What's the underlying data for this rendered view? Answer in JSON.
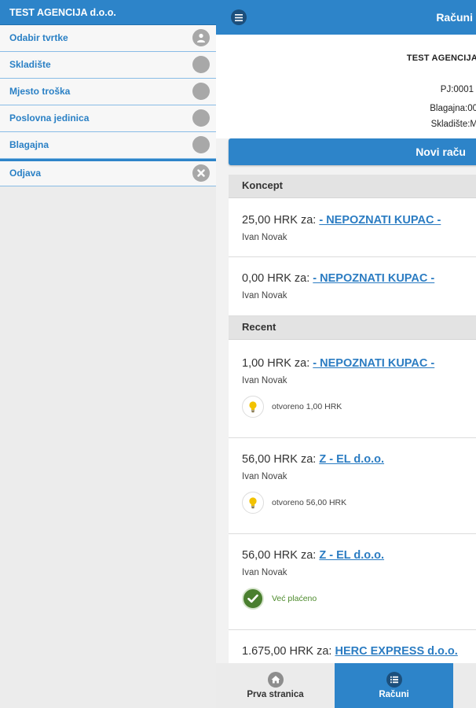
{
  "sidebar": {
    "title": "TEST AGENCIJA d.o.o.",
    "items": [
      {
        "label": "Odabir tvrtke",
        "icon": "user-icon"
      },
      {
        "label": "Skladište",
        "icon": "circle-icon"
      },
      {
        "label": "Mjesto troška",
        "icon": "circle-icon"
      },
      {
        "label": "Poslovna jedinica",
        "icon": "circle-icon"
      },
      {
        "label": "Blagajna",
        "icon": "circle-icon"
      },
      {
        "label": "Odjava",
        "icon": "close-icon"
      }
    ]
  },
  "header": {
    "title": "Računi",
    "menu_icon": "hamburger-icon"
  },
  "company": {
    "name": "TEST AGENCIJA",
    "pj": "PJ:0001",
    "blagajna": "Blagajna:00",
    "skladiste": "Skladište:M"
  },
  "new_invoice_label": "Novi raču",
  "sections": {
    "koncept": "Koncept",
    "recent": "Recent"
  },
  "invoices": {
    "concept": [
      {
        "amount": "25,00 HRK za:",
        "customer": "- NEPOZNATI KUPAC -",
        "user": "Ivan Novak"
      },
      {
        "amount": "0,00 HRK za:",
        "customer": "- NEPOZNATI KUPAC -",
        "user": "Ivan Novak"
      }
    ],
    "recent": [
      {
        "amount": "1,00 HRK za:",
        "customer": "- NEPOZNATI KUPAC -",
        "user": "Ivan Novak",
        "status": "otvoreno 1,00 HRK",
        "status_icon": "lightbulb-icon"
      },
      {
        "amount": "56,00 HRK za:",
        "customer": "Z - EL d.o.o.",
        "user": "Ivan Novak",
        "status": "otvoreno 56,00 HRK",
        "status_icon": "lightbulb-icon"
      },
      {
        "amount": "56,00 HRK za:",
        "customer": "Z - EL d.o.o.",
        "user": "Ivan Novak",
        "status": "Već plaćeno",
        "status_icon": "check-icon"
      },
      {
        "amount": "1.675,00 HRK za:",
        "customer": "HERC EXPRESS d.o.o."
      }
    ]
  },
  "bottom_nav": [
    {
      "label": "Prva stranica",
      "icon": "home-icon"
    },
    {
      "label": "Računi",
      "icon": "list-icon",
      "active": true
    }
  ],
  "colors": {
    "primary": "#2d84c9",
    "link": "#2b7cc2",
    "paid": "#4d8b2c",
    "bulb": "#f2c200"
  }
}
